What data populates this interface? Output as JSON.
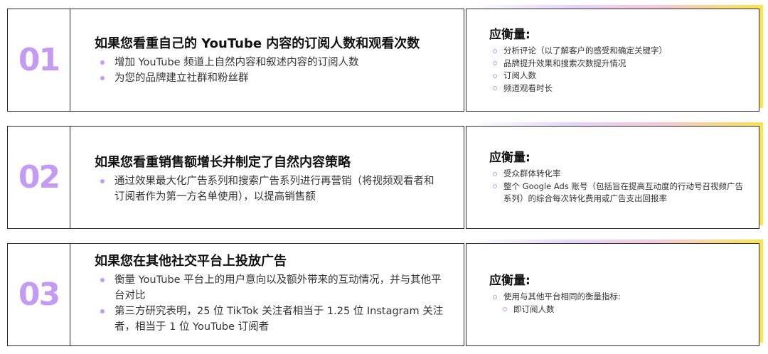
{
  "rows": [
    {
      "num": "01",
      "title": "如果您看重自己的 YouTube 内容的订阅人数和观看次数",
      "bullets": [
        "增加 YouTube 频道上自然内容和叙述内容的订阅人数",
        "为您的品牌建立社群和粉丝群"
      ],
      "measure_title": "应衡量:",
      "measures": [
        "分析评论（以了解客户的感受和确定关键字）",
        "品牌提升效果和搜索次数提升情况",
        "订阅人数",
        "频道观看时长"
      ]
    },
    {
      "num": "02",
      "title": "如果您看重销售额增长并制定了自然内容策略",
      "bullets": [
        "通过效果最大化广告系列和搜索广告系列进行再营销（将视频观看者和订阅者作为第一方名单使用），以提高销售额"
      ],
      "measure_title": "应衡量:",
      "measures": [
        "受众群体转化率",
        "整个 Google Ads 账号（包括旨在提高互动度的行动号召视频广告系列）的综合每次转化费用或广告支出回报率"
      ]
    },
    {
      "num": "03",
      "title": "如果您在其他社交平台上投放广告",
      "bullets": [
        "衡量 YouTube 平台上的用户意向以及额外带来的互动情况，并与其他平台对比",
        "第三方研究表明，25 位 TikTok 关注者相当于 1.25 位 Instagram 关注者，相当于 1 位 YouTube 订阅者"
      ],
      "measure_title": "应衡量:",
      "measures": [
        "使用与其他平台相同的衡量指标:",
        "即订阅人数"
      ]
    }
  ],
  "colors": {
    "accent_purple": "#c39bf2",
    "border": "#2b2b2b",
    "gradient_yellow": "#fbe34a"
  }
}
